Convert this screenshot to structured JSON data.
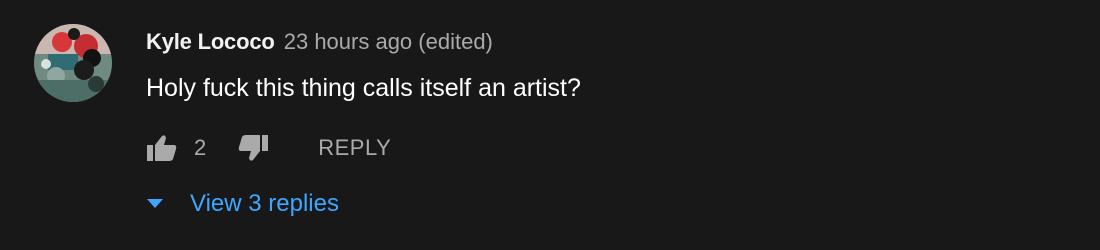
{
  "comment": {
    "author": "Kyle Lococo",
    "meta": "23 hours ago (edited)",
    "text": "Holy fuck this thing calls itself an artist?",
    "like_count": "2",
    "reply_label": "REPLY",
    "view_replies_label": "View 3 replies"
  },
  "icons": {
    "like": "thumbs-up-icon",
    "dislike": "thumbs-down-icon",
    "expand": "caret-down-icon"
  },
  "colors": {
    "background": "#181818",
    "author": "#f1f1f1",
    "meta": "#aaaaaa",
    "text": "#ffffff",
    "link": "#3ea6ff"
  }
}
